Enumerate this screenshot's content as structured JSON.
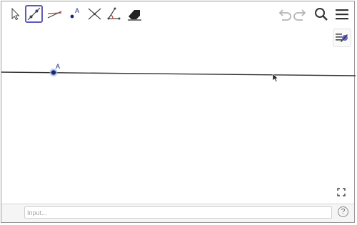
{
  "toolbar": {
    "tools": [
      {
        "name": "move-tool-icon"
      },
      {
        "name": "line-tool-icon",
        "active": true
      },
      {
        "name": "segment-tool-icon"
      },
      {
        "name": "point-tool-icon"
      },
      {
        "name": "intersect-tool-icon"
      },
      {
        "name": "angle-tool-icon"
      },
      {
        "name": "eraser-tool-icon"
      }
    ],
    "right_icons": [
      "undo-icon",
      "redo-icon",
      "search-icon",
      "menu-icon"
    ]
  },
  "graphics": {
    "point_label": "A"
  },
  "input_bar": {
    "placeholder": "Input...",
    "help_label": "?"
  },
  "colors": {
    "accent": "#5d5bb4",
    "point_fill": "#1a237e",
    "line": "#333333"
  }
}
